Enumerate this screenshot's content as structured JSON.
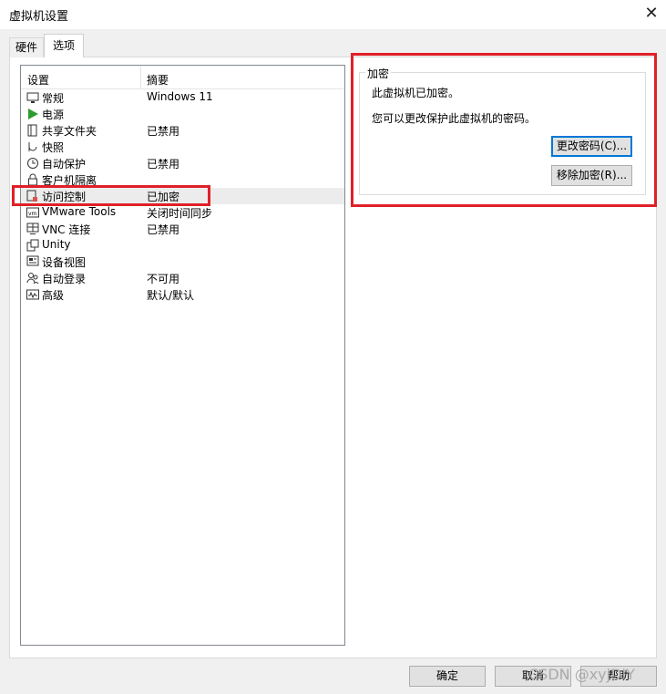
{
  "window": {
    "title": "虚拟机设置",
    "close_glyph": "✕"
  },
  "tabs": [
    {
      "label": "硬件"
    },
    {
      "label": "选项"
    }
  ],
  "list": {
    "headers": {
      "setting": "设置",
      "summary": "摘要"
    },
    "items": [
      {
        "name": "常规",
        "summary": "Windows 11",
        "icon": "monitor-icon"
      },
      {
        "name": "电源",
        "summary": "",
        "icon": "play-icon"
      },
      {
        "name": "共享文件夹",
        "summary": "已禁用",
        "icon": "shared-folder-icon"
      },
      {
        "name": "快照",
        "summary": "",
        "icon": "snapshot-icon"
      },
      {
        "name": "自动保护",
        "summary": "已禁用",
        "icon": "clock-icon"
      },
      {
        "name": "客户机隔离",
        "summary": "",
        "icon": "lock-icon"
      },
      {
        "name": "访问控制",
        "summary": "已加密",
        "icon": "access-control-icon"
      },
      {
        "name": "VMware Tools",
        "summary": "关闭时间同步",
        "icon": "vm-icon"
      },
      {
        "name": "VNC 连接",
        "summary": "已禁用",
        "icon": "vnc-icon"
      },
      {
        "name": "Unity",
        "summary": "",
        "icon": "unity-icon"
      },
      {
        "name": "设备视图",
        "summary": "",
        "icon": "device-view-icon"
      },
      {
        "name": "自动登录",
        "summary": "不可用",
        "icon": "users-icon"
      },
      {
        "name": "高级",
        "summary": "默认/默认",
        "icon": "advanced-icon"
      }
    ]
  },
  "encryption": {
    "group_label": "加密",
    "status_text": "此虚拟机已加密。",
    "info_text": "您可以更改保护此虚拟机的密码。",
    "change_button": "更改密码(C)...",
    "remove_button": "移除加密(R)..."
  },
  "footer": {
    "ok": "确定",
    "cancel": "取消",
    "help": "帮助"
  },
  "watermark": "CSDN @xyjDIY",
  "colors": {
    "highlight_box": "#e02028",
    "focus_border": "#0078d7"
  }
}
